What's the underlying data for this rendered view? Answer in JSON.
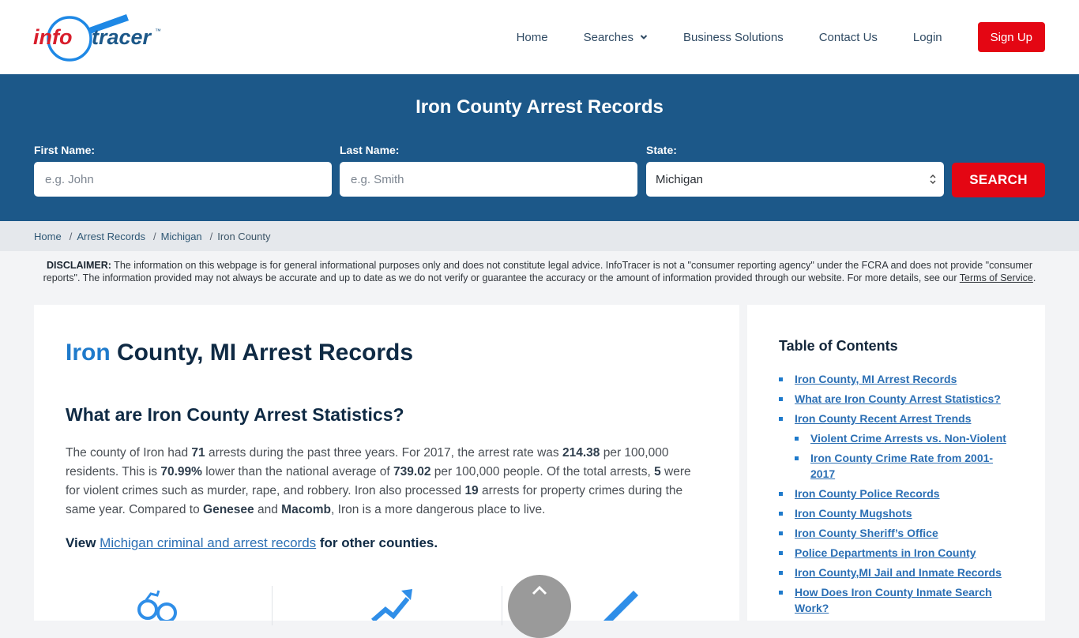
{
  "brand": {
    "logo_left": "info",
    "logo_right": "tracer",
    "trademark": "™",
    "accent": "#e40613",
    "primary": "#1c5889"
  },
  "nav": {
    "items": [
      "Home",
      "Searches",
      "Business Solutions",
      "Contact Us",
      "Login"
    ],
    "signup": "Sign Up"
  },
  "search": {
    "title": "Iron County Arrest Records",
    "first_name_label": "First Name:",
    "first_name_placeholder": "e.g. John",
    "last_name_label": "Last Name:",
    "last_name_placeholder": "e.g. Smith",
    "state_label": "State:",
    "state_value": "Michigan",
    "button": "SEARCH"
  },
  "breadcrumb": [
    "Home",
    "Arrest Records",
    "Michigan",
    "Iron County"
  ],
  "disclaimer": {
    "label": "DISCLAIMER:",
    "text": " The information on this webpage is for general informational purposes only and does not constitute legal advice. InfoTracer is not a \"consumer reporting agency\" under the FCRA and does not provide \"consumer reports\". The information provided may not always be accurate and up to date as we do not verify or guarantee the accuracy or the amount of information provided through our website. For more details, see our ",
    "link": "Terms of Service",
    "end": "."
  },
  "article": {
    "title_highlight": "Iron",
    "title_rest": " County, MI Arrest Records",
    "stats_heading": "What are Iron County Arrest Statistics?",
    "stats": {
      "p1": "The county of Iron had ",
      "arrests": "71",
      "p2": " arrests during the past three years. For 2017, the arrest rate was ",
      "rate": "214.38",
      "p3": " per 100,000 residents. This is ",
      "pct": "70.99%",
      "p4": " lower than the national average of ",
      "national": "739.02",
      "p5": " per 100,000 people. Of the total arrests, ",
      "violent": "5",
      "p6": " were for violent crimes such as murder, rape, and robbery. Iron also processed ",
      "property": "19",
      "p7": " arrests for property crimes during the same year. Compared to ",
      "county1": "Genesee",
      "p8": " and ",
      "county2": "Macomb",
      "p9": ", Iron is a more dangerous place to live."
    },
    "view_prefix": "View ",
    "view_link": "Michigan criminal and arrest records",
    "view_suffix": " for other counties."
  },
  "toc": {
    "title": "Table of Contents",
    "items": [
      {
        "label": "Iron County, MI Arrest Records",
        "sub": false
      },
      {
        "label": "What are Iron County Arrest Statistics?",
        "sub": false
      },
      {
        "label": "Iron County Recent Arrest Trends",
        "sub": false
      },
      {
        "label": "Violent Crime Arrests vs. Non-Violent",
        "sub": true
      },
      {
        "label": "Iron County Crime Rate from 2001-2017",
        "sub": true
      },
      {
        "label": "Iron County Police Records",
        "sub": false
      },
      {
        "label": "Iron County Mugshots",
        "sub": false
      },
      {
        "label": "Iron County Sheriff’s Office",
        "sub": false
      },
      {
        "label": "Police Departments in Iron County",
        "sub": false
      },
      {
        "label": "Iron County,MI Jail and Inmate Records",
        "sub": false
      },
      {
        "label": "How Does Iron County Inmate Search Work?",
        "sub": false
      }
    ]
  },
  "icons": [
    "handcuffs-icon",
    "trend-up-arrow-icon",
    "baton-icon"
  ],
  "scroll_top": "scroll-to-top"
}
